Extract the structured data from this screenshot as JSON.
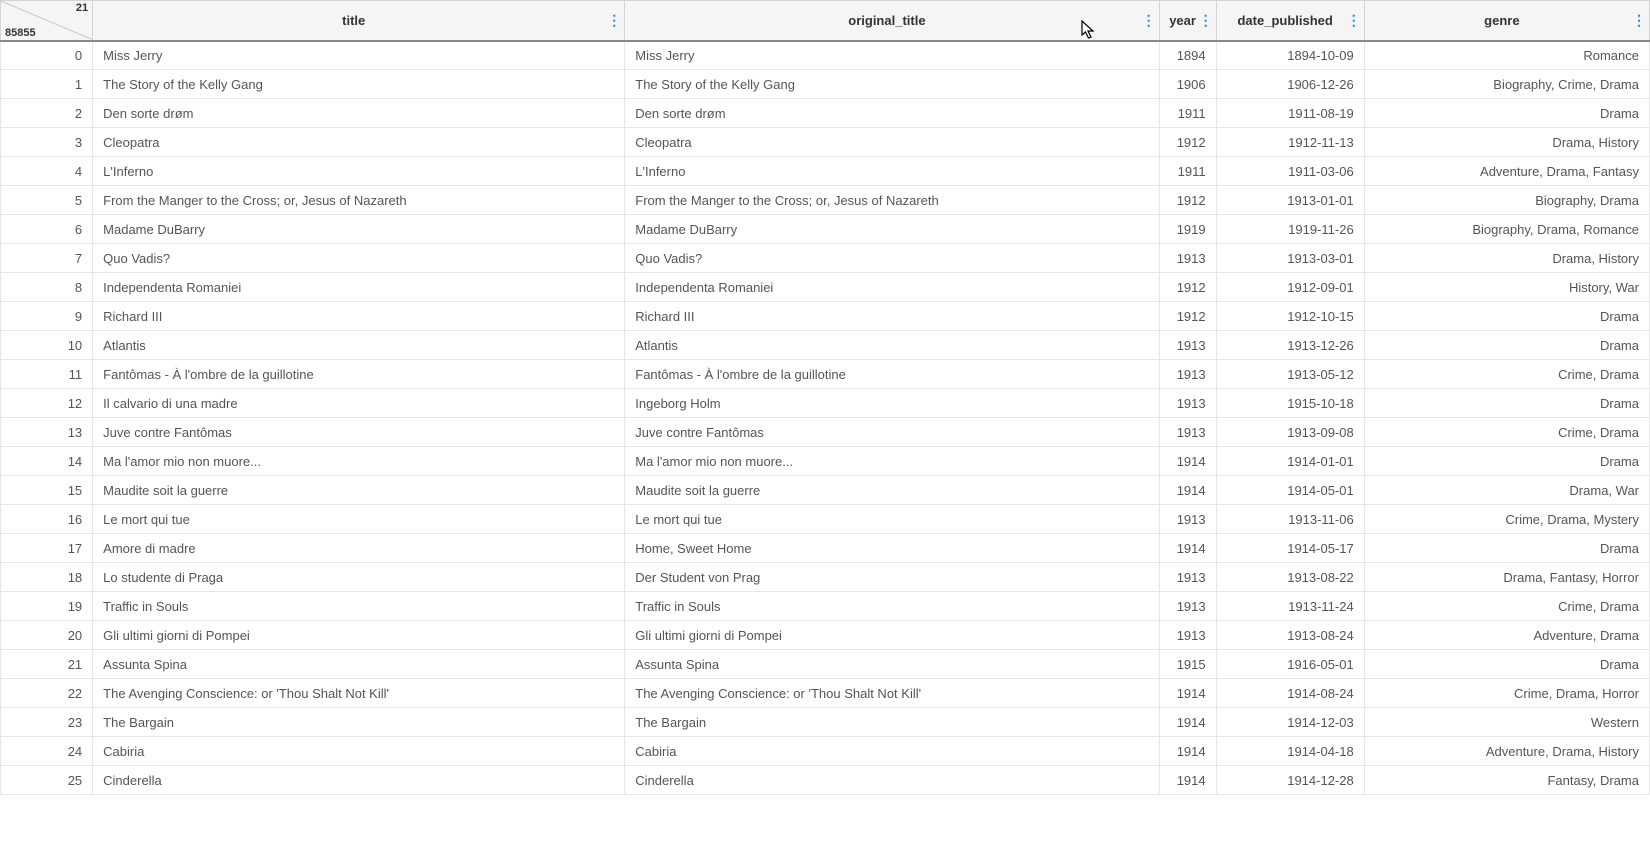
{
  "corner": {
    "total_cols": "21",
    "total_rows": "85855"
  },
  "columns": [
    {
      "key": "title",
      "label": "title",
      "align": "txt",
      "cls": "col-title"
    },
    {
      "key": "original_title",
      "label": "original_title",
      "align": "txt",
      "cls": "col-original-title"
    },
    {
      "key": "year",
      "label": "year",
      "align": "num",
      "cls": "col-year"
    },
    {
      "key": "date_published",
      "label": "date_published",
      "align": "num",
      "cls": "col-date-published"
    },
    {
      "key": "genre",
      "label": "genre",
      "align": "num",
      "cls": "col-genre"
    }
  ],
  "rows": [
    {
      "idx": "0",
      "title": "Miss Jerry",
      "original_title": "Miss Jerry",
      "year": "1894",
      "date_published": "1894-10-09",
      "genre": "Romance"
    },
    {
      "idx": "1",
      "title": "The Story of the Kelly Gang",
      "original_title": "The Story of the Kelly Gang",
      "year": "1906",
      "date_published": "1906-12-26",
      "genre": "Biography, Crime, Drama"
    },
    {
      "idx": "2",
      "title": "Den sorte drøm",
      "original_title": "Den sorte drøm",
      "year": "1911",
      "date_published": "1911-08-19",
      "genre": "Drama"
    },
    {
      "idx": "3",
      "title": "Cleopatra",
      "original_title": "Cleopatra",
      "year": "1912",
      "date_published": "1912-11-13",
      "genre": "Drama, History"
    },
    {
      "idx": "4",
      "title": "L'Inferno",
      "original_title": "L'Inferno",
      "year": "1911",
      "date_published": "1911-03-06",
      "genre": "Adventure, Drama, Fantasy"
    },
    {
      "idx": "5",
      "title": "From the Manger to the Cross; or, Jesus of Nazareth",
      "original_title": "From the Manger to the Cross; or, Jesus of Nazareth",
      "year": "1912",
      "date_published": "1913-01-01",
      "genre": "Biography, Drama"
    },
    {
      "idx": "6",
      "title": "Madame DuBarry",
      "original_title": "Madame DuBarry",
      "year": "1919",
      "date_published": "1919-11-26",
      "genre": "Biography, Drama, Romance"
    },
    {
      "idx": "7",
      "title": "Quo Vadis?",
      "original_title": "Quo Vadis?",
      "year": "1913",
      "date_published": "1913-03-01",
      "genre": "Drama, History"
    },
    {
      "idx": "8",
      "title": "Independenta Romaniei",
      "original_title": "Independenta Romaniei",
      "year": "1912",
      "date_published": "1912-09-01",
      "genre": "History, War"
    },
    {
      "idx": "9",
      "title": "Richard III",
      "original_title": "Richard III",
      "year": "1912",
      "date_published": "1912-10-15",
      "genre": "Drama"
    },
    {
      "idx": "10",
      "title": "Atlantis",
      "original_title": "Atlantis",
      "year": "1913",
      "date_published": "1913-12-26",
      "genre": "Drama"
    },
    {
      "idx": "11",
      "title": "Fantômas - À l'ombre de la guillotine",
      "original_title": "Fantômas - À l'ombre de la guillotine",
      "year": "1913",
      "date_published": "1913-05-12",
      "genre": "Crime, Drama"
    },
    {
      "idx": "12",
      "title": "Il calvario di una madre",
      "original_title": "Ingeborg Holm",
      "year": "1913",
      "date_published": "1915-10-18",
      "genre": "Drama"
    },
    {
      "idx": "13",
      "title": "Juve contre Fantômas",
      "original_title": "Juve contre Fantômas",
      "year": "1913",
      "date_published": "1913-09-08",
      "genre": "Crime, Drama"
    },
    {
      "idx": "14",
      "title": "Ma l'amor mio non muore...",
      "original_title": "Ma l'amor mio non muore...",
      "year": "1914",
      "date_published": "1914-01-01",
      "genre": "Drama"
    },
    {
      "idx": "15",
      "title": "Maudite soit la guerre",
      "original_title": "Maudite soit la guerre",
      "year": "1914",
      "date_published": "1914-05-01",
      "genre": "Drama, War"
    },
    {
      "idx": "16",
      "title": "Le mort qui tue",
      "original_title": "Le mort qui tue",
      "year": "1913",
      "date_published": "1913-11-06",
      "genre": "Crime, Drama, Mystery"
    },
    {
      "idx": "17",
      "title": "Amore di madre",
      "original_title": "Home, Sweet Home",
      "year": "1914",
      "date_published": "1914-05-17",
      "genre": "Drama"
    },
    {
      "idx": "18",
      "title": "Lo studente di Praga",
      "original_title": "Der Student von Prag",
      "year": "1913",
      "date_published": "1913-08-22",
      "genre": "Drama, Fantasy, Horror"
    },
    {
      "idx": "19",
      "title": "Traffic in Souls",
      "original_title": "Traffic in Souls",
      "year": "1913",
      "date_published": "1913-11-24",
      "genre": "Crime, Drama"
    },
    {
      "idx": "20",
      "title": "Gli ultimi giorni di Pompei",
      "original_title": "Gli ultimi giorni di Pompei",
      "year": "1913",
      "date_published": "1913-08-24",
      "genre": "Adventure, Drama"
    },
    {
      "idx": "21",
      "title": "Assunta Spina",
      "original_title": "Assunta Spina",
      "year": "1915",
      "date_published": "1916-05-01",
      "genre": "Drama"
    },
    {
      "idx": "22",
      "title": "The Avenging Conscience: or 'Thou Shalt Not Kill'",
      "original_title": "The Avenging Conscience: or 'Thou Shalt Not Kill'",
      "year": "1914",
      "date_published": "1914-08-24",
      "genre": "Crime, Drama, Horror"
    },
    {
      "idx": "23",
      "title": "The Bargain",
      "original_title": "The Bargain",
      "year": "1914",
      "date_published": "1914-12-03",
      "genre": "Western"
    },
    {
      "idx": "24",
      "title": "Cabiria",
      "original_title": "Cabiria",
      "year": "1914",
      "date_published": "1914-04-18",
      "genre": "Adventure, Drama, History"
    },
    {
      "idx": "25",
      "title": "Cinderella",
      "original_title": "Cinderella",
      "year": "1914",
      "date_published": "1914-12-28",
      "genre": "Fantasy, Drama"
    }
  ]
}
